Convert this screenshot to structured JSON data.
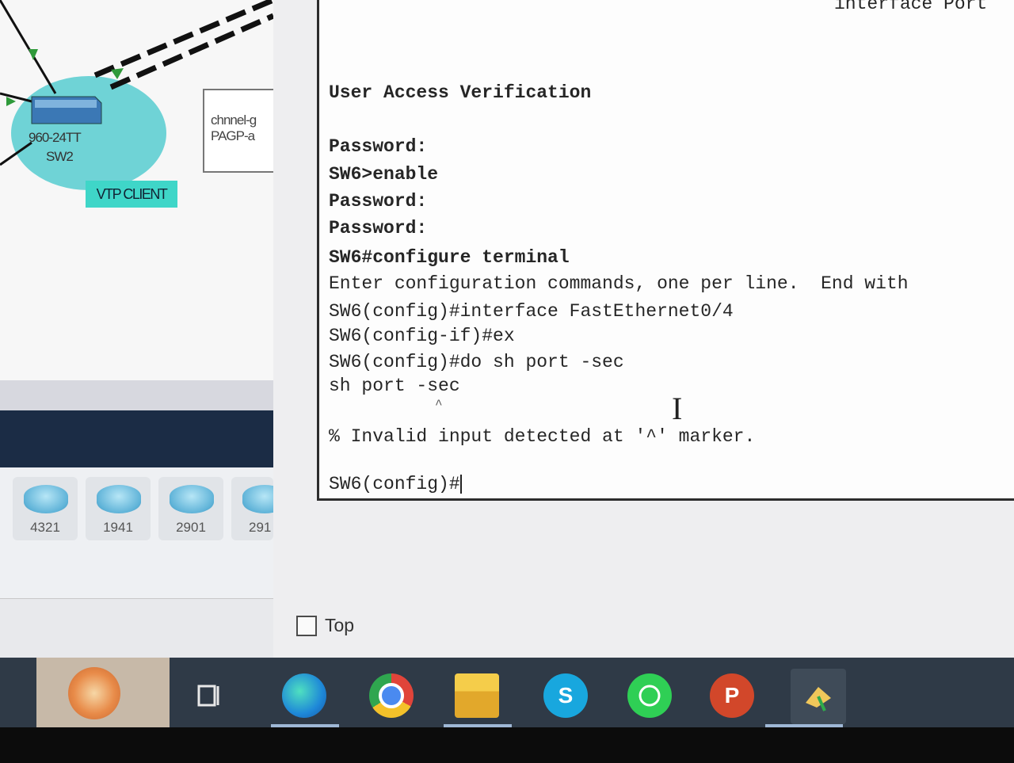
{
  "topology": {
    "switch_model": "960-24TT",
    "switch_name": "SW2",
    "note_line1": "chnnel-g",
    "note_line2": "PAGP-a",
    "vtp_tag": "VTP CLIENT"
  },
  "devices": [
    {
      "label": "4321"
    },
    {
      "label": "1941"
    },
    {
      "label": "2901"
    },
    {
      "label": "291"
    }
  ],
  "cli": {
    "top_cut": "interface Port",
    "lines": [
      "User Access Verification",
      "Password:",
      "SW6>enable",
      "Password:",
      "Password:",
      "SW6#configure terminal",
      "Enter configuration commands, one per line.  End with",
      "SW6(config)#interface FastEthernet0/4",
      "SW6(config-if)#ex",
      "SW6(config)#do sh port -sec",
      "sh port -sec",
      "^",
      "% Invalid input detected at '^' marker.",
      "SW6(config)#"
    ]
  },
  "top_checkbox": {
    "label": "Top",
    "checked": false
  },
  "taskbar": {
    "icons": [
      "task-view-icon",
      "edge-icon",
      "chrome-icon",
      "file-explorer-icon",
      "skype-icon",
      "whatsapp-icon",
      "powerpoint-icon",
      "packet-tracer-icon"
    ],
    "skype_glyph": "S",
    "powerpoint_glyph": "P"
  }
}
